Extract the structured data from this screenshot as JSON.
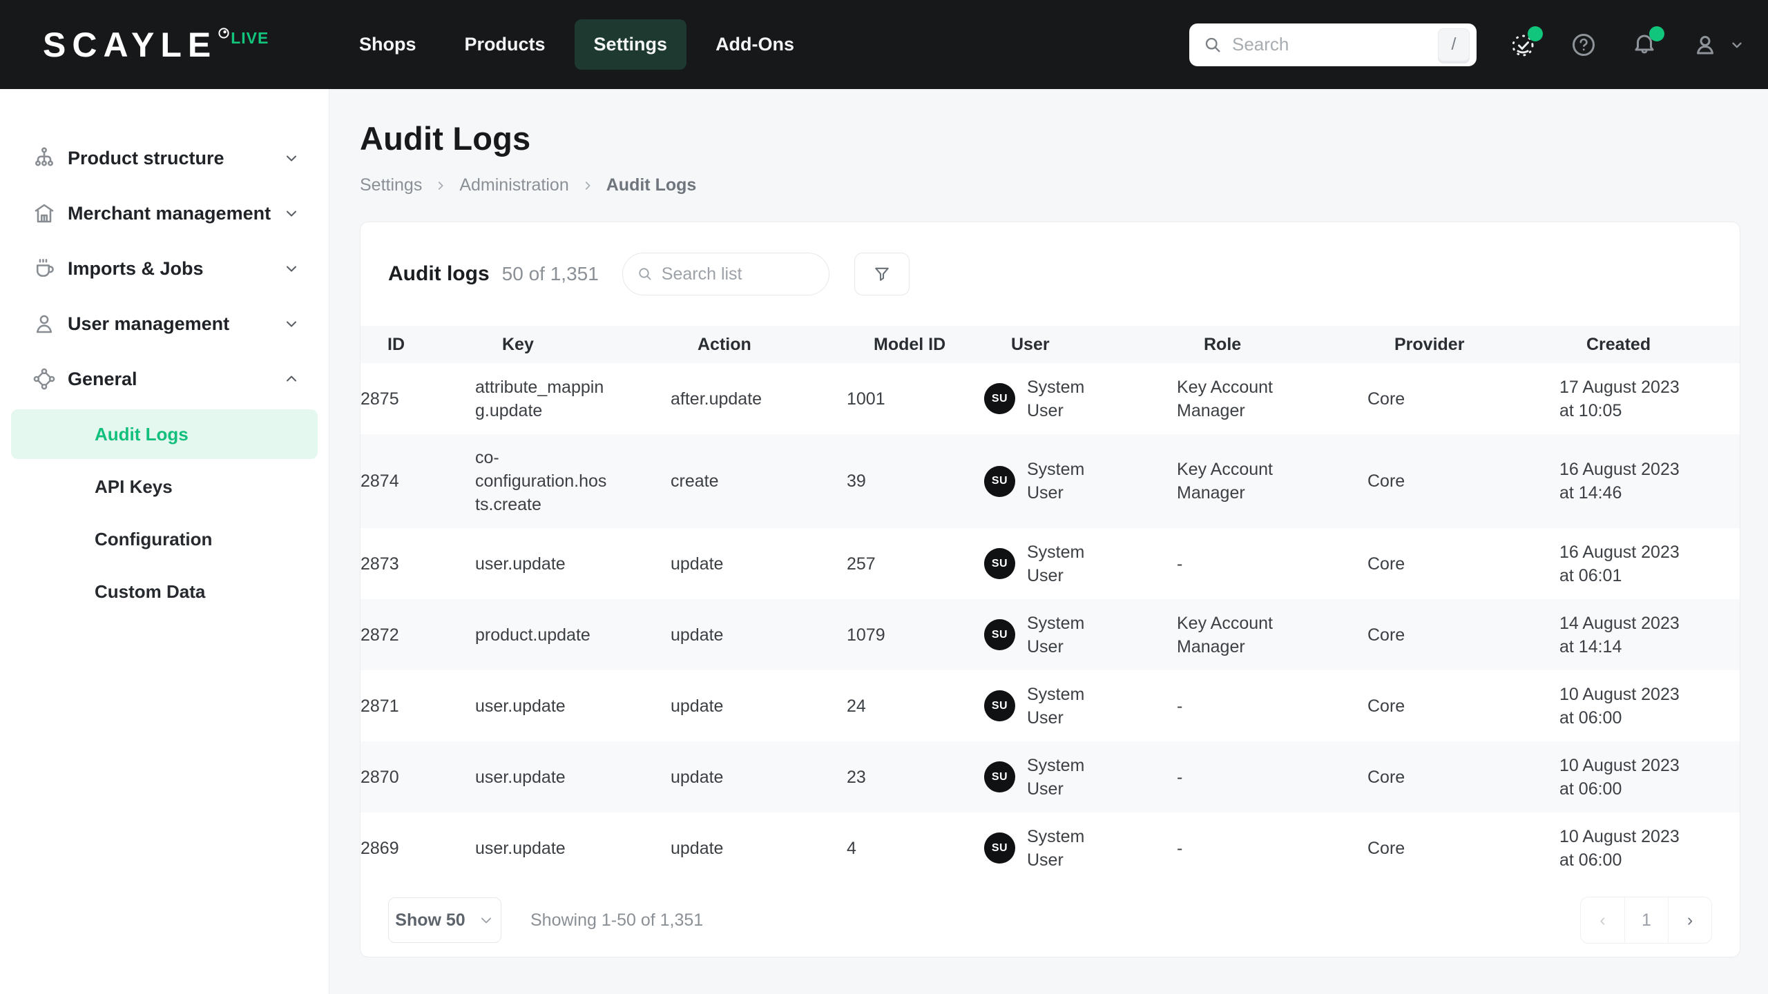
{
  "navbar": {
    "logo": "SCAYLE",
    "logo_badge": "LIVE",
    "items": [
      {
        "label": "Shops",
        "active": false
      },
      {
        "label": "Products",
        "active": false
      },
      {
        "label": "Settings",
        "active": true
      },
      {
        "label": "Add-Ons",
        "active": false
      }
    ],
    "search": {
      "placeholder": "Search",
      "shortcut": "/"
    },
    "icons": [
      {
        "name": "status-check-icon",
        "badge": true
      },
      {
        "name": "help-icon",
        "badge": false
      },
      {
        "name": "notifications-icon",
        "badge": true
      },
      {
        "name": "user-menu-icon",
        "badge": false
      }
    ]
  },
  "sidebar": {
    "sections": [
      {
        "label": "Product structure",
        "icon": "hierarchy-icon",
        "state": "collapsed"
      },
      {
        "label": "Merchant management",
        "icon": "store-icon",
        "state": "collapsed"
      },
      {
        "label": "Imports & Jobs",
        "icon": "mug-icon",
        "state": "collapsed"
      },
      {
        "label": "User management",
        "icon": "person-icon",
        "state": "collapsed"
      },
      {
        "label": "General",
        "icon": "nodes-icon",
        "state": "expanded"
      }
    ],
    "general_children": [
      {
        "label": "Audit Logs",
        "active": true
      },
      {
        "label": "API Keys",
        "active": false
      },
      {
        "label": "Configuration",
        "active": false
      },
      {
        "label": "Custom Data",
        "active": false
      }
    ]
  },
  "page": {
    "title": "Audit Logs",
    "breadcrumb": [
      "Settings",
      "Administration",
      "Audit Logs"
    ]
  },
  "table_card": {
    "title": "Audit logs",
    "count_label": "50 of 1,351",
    "search_placeholder": "Search list",
    "columns": [
      "ID",
      "Key",
      "Action",
      "Model ID",
      "User",
      "Role",
      "Provider",
      "Created"
    ],
    "rows": [
      {
        "id": "2875",
        "key": "attribute_mapping.update",
        "action": "after.update",
        "model_id": "1001",
        "user_initials": "SU",
        "user_name": "System User",
        "role": "Key Account Manager",
        "provider": "Core",
        "created_date": "17 August 2023",
        "created_time": "at 10:05"
      },
      {
        "id": "2874",
        "key": "co-configuration.hosts.create",
        "action": "create",
        "model_id": "39",
        "user_initials": "SU",
        "user_name": "System User",
        "role": "Key Account Manager",
        "provider": "Core",
        "created_date": "16 August 2023",
        "created_time": "at 14:46"
      },
      {
        "id": "2873",
        "key": "user.update",
        "action": "update",
        "model_id": "257",
        "user_initials": "SU",
        "user_name": "System User",
        "role": "-",
        "provider": "Core",
        "created_date": "16 August 2023",
        "created_time": "at 06:01"
      },
      {
        "id": "2872",
        "key": "product.update",
        "action": "update",
        "model_id": "1079",
        "user_initials": "SU",
        "user_name": "System User",
        "role": "Key Account Manager",
        "provider": "Core",
        "created_date": "14 August 2023",
        "created_time": "at 14:14"
      },
      {
        "id": "2871",
        "key": "user.update",
        "action": "update",
        "model_id": "24",
        "user_initials": "SU",
        "user_name": "System User",
        "role": "-",
        "provider": "Core",
        "created_date": "10 August 2023",
        "created_time": "at 06:00"
      },
      {
        "id": "2870",
        "key": "user.update",
        "action": "update",
        "model_id": "23",
        "user_initials": "SU",
        "user_name": "System User",
        "role": "-",
        "provider": "Core",
        "created_date": "10 August 2023",
        "created_time": "at 06:00"
      },
      {
        "id": "2869",
        "key": "user.update",
        "action": "update",
        "model_id": "4",
        "user_initials": "SU",
        "user_name": "System User",
        "role": "-",
        "provider": "Core",
        "created_date": "10 August 2023",
        "created_time": "at 06:00"
      }
    ],
    "footer": {
      "page_size_label": "Show 50",
      "showing_label": "Showing 1-50 of 1,351",
      "pagination": {
        "prev": "‹",
        "current_page": "1",
        "next": "›"
      }
    }
  },
  "colors": {
    "accent_green": "#12C57C",
    "navbar_bg": "#17181A",
    "active_nav_bg": "#1E3A30",
    "sidebar_active_bg": "#E4F8EF",
    "page_bg": "#F6F7F9",
    "avatar_bg": "#101112"
  }
}
